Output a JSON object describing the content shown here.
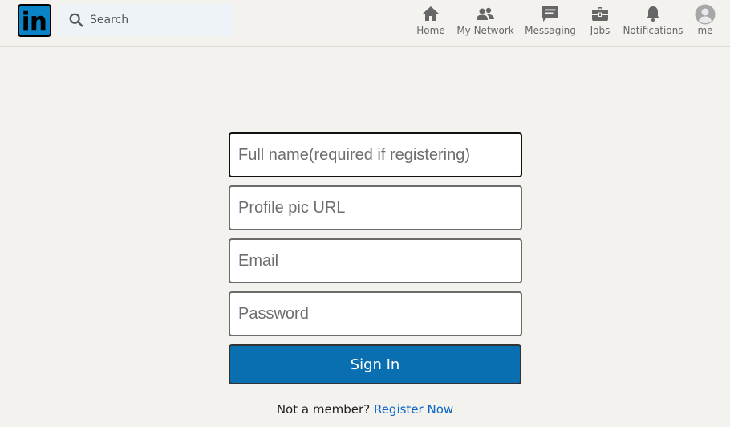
{
  "header": {
    "logo_text": "in",
    "search": {
      "placeholder": "Search"
    },
    "nav": [
      {
        "label": "Home",
        "icon": "home-icon"
      },
      {
        "label": "My Network",
        "icon": "people-icon"
      },
      {
        "label": "Messaging",
        "icon": "message-icon"
      },
      {
        "label": "Jobs",
        "icon": "briefcase-icon"
      },
      {
        "label": "Notifications",
        "icon": "bell-icon"
      },
      {
        "label": "me",
        "icon": "avatar-icon"
      }
    ]
  },
  "form": {
    "fullname_placeholder": "Full name(required if registering)",
    "profile_pic_placeholder": "Profile pic URL",
    "email_placeholder": "Email",
    "password_placeholder": "Password",
    "signin_label": "Sign In",
    "not_member_text": "Not a member?",
    "register_link": "Register Now"
  },
  "colors": {
    "background": "#f3f2ef",
    "brand": "#0a84c6",
    "button": "#0a6fb0",
    "link": "#0a66c2"
  }
}
